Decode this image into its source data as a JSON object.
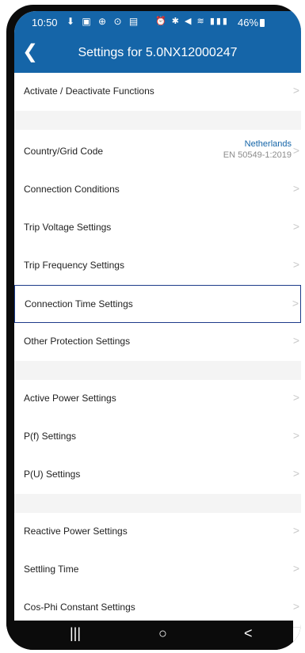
{
  "status_bar": {
    "time": "10:50",
    "battery": "46%"
  },
  "header": {
    "title": "Settings for 5.0NX12000247"
  },
  "rows": [
    {
      "label": "Activate / Deactivate Functions"
    },
    {
      "label": "Country/Grid Code",
      "value": "Netherlands",
      "subvalue": "EN 50549-1:2019"
    },
    {
      "label": "Connection Conditions"
    },
    {
      "label": "Trip Voltage Settings"
    },
    {
      "label": "Trip Frequency Settings"
    },
    {
      "label": "Connection Time Settings"
    },
    {
      "label": "Other Protection Settings"
    },
    {
      "label": "Active Power Settings"
    },
    {
      "label": "P(f) Settings"
    },
    {
      "label": "P(U) Settings"
    },
    {
      "label": "Reactive Power Settings"
    },
    {
      "label": "Settling Time"
    },
    {
      "label": "Cos-Phi Constant Settings"
    }
  ],
  "icons": {
    "back": "back-arrow-icon",
    "chevron": "chevron-right-icon",
    "nav_recents": "recents-icon",
    "nav_home": "home-icon",
    "nav_back": "back-icon"
  },
  "colors": {
    "accent": "#1565a8",
    "selected_border": "#1d3b8a"
  }
}
